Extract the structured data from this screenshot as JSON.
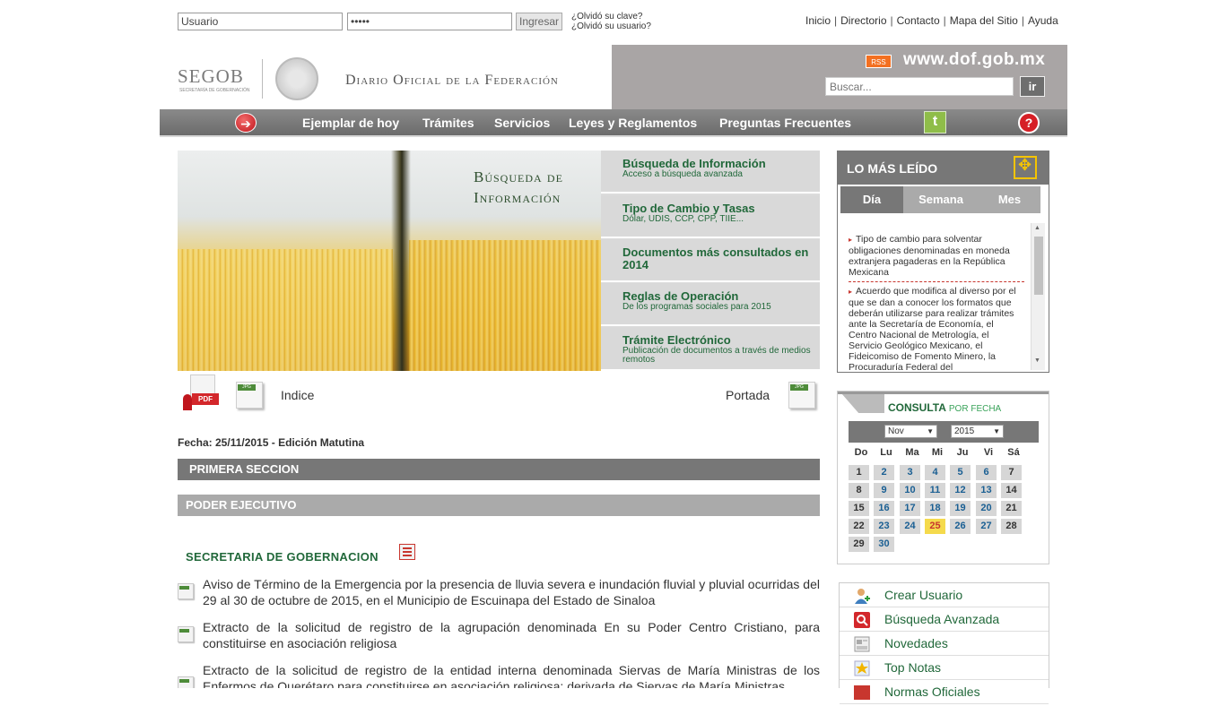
{
  "login": {
    "user_value": "Usuario",
    "password_value": "•••••",
    "submit_label": "Ingresar",
    "forgot_password": "¿Olvidó su clave?",
    "forgot_user": "¿Olvidó su usuario?"
  },
  "top_links": [
    "Inicio",
    "Directorio",
    "Contacto",
    "Mapa del Sitio",
    "Ayuda"
  ],
  "header": {
    "logo_text": "SEGOB",
    "logo_sub": "SECRETARÍA DE GOBERNACIÓN",
    "site_title": "Diario Oficial de la Federación",
    "rss_label": "RSS",
    "site_url": "www.dof.gob.mx",
    "search_placeholder": "Buscar...",
    "search_button": "ir"
  },
  "nav": {
    "items": [
      "Ejemplar de hoy",
      "Trámites",
      "Servicios",
      "Leyes y Reglamentos",
      "Preguntas Frecuentes"
    ],
    "back_icon": "back-arrow-icon",
    "twitter_icon": "twitter-icon",
    "help_icon": "help-icon"
  },
  "banner": {
    "title_line1": "Búsqueda de",
    "title_line2": "Información"
  },
  "feature_links": [
    {
      "title": "Búsqueda de Información",
      "sub": "Acceso a búsqueda avanzada"
    },
    {
      "title": "Tipo de Cambio y Tasas",
      "sub": "Dólar, UDIS, CCP, CPP, TIIE..."
    },
    {
      "title": "Documentos más consultados en 2014",
      "sub": ""
    },
    {
      "title": "Reglas de Operación",
      "sub": "De los programas sociales para 2015"
    },
    {
      "title": "Trámite Electrónico",
      "sub": "Publicación de documentos a través de medios remotos"
    }
  ],
  "downloads": {
    "pdf_label": "PDF",
    "jpg_label": "JPG",
    "indice": "Indice",
    "portada": "Portada"
  },
  "edition": {
    "fecha": "Fecha: 25/11/2015 - Edición Matutina",
    "section": "PRIMERA SECCION",
    "branch": "PODER EJECUTIVO",
    "department": "SECRETARIA DE GOBERNACION"
  },
  "documents": [
    "Aviso de Término de la Emergencia por la presencia de lluvia severa e inundación fluvial y pluvial ocurridas del 29 al 30 de octubre de 2015, en el Municipio de Escuinapa del Estado de Sinaloa",
    "Extracto de la solicitud de registro de la agrupación denominada En su Poder Centro Cristiano, para constituirse en asociación religiosa",
    "Extracto de la solicitud de registro de la entidad interna denominada Siervas de María Ministras de los Enfermos de Querétaro para constituirse en asociación religiosa; derivada de Siervas de María Ministras"
  ],
  "mas_leido": {
    "title": "LO MÁS LEÍDO",
    "tabs": [
      "Día",
      "Semana",
      "Mes"
    ],
    "items": [
      "Tipo de cambio para solventar obligaciones denominadas en moneda extranjera pagaderas en la República Mexicana",
      "Acuerdo que modifica al diverso por el que se dan a conocer los formatos que deberán utilizarse para realizar trámites ante la Secretaría de Economía, el Centro Nacional de Metrología, el Servicio Geológico Mexicano, el Fideicomiso de Fomento Minero, la Procuraduría Federal del"
    ]
  },
  "calendar": {
    "title": "CONSULTA",
    "title_small": "POR FECHA",
    "month": "Nov",
    "year": "2015",
    "dow": [
      "Do",
      "Lu",
      "Ma",
      "Mi",
      "Ju",
      "Vi",
      "Sá"
    ],
    "days": [
      "1",
      "2",
      "3",
      "4",
      "5",
      "6",
      "7",
      "8",
      "9",
      "10",
      "11",
      "12",
      "13",
      "14",
      "15",
      "16",
      "17",
      "18",
      "19",
      "20",
      "21",
      "22",
      "23",
      "24",
      "25",
      "26",
      "27",
      "28",
      "29",
      "30"
    ],
    "today": "25"
  },
  "side_links": [
    {
      "label": "Crear Usuario",
      "icon": "user-add-icon"
    },
    {
      "label": "Búsqueda Avanzada",
      "icon": "search-icon"
    },
    {
      "label": "Novedades",
      "icon": "news-icon"
    },
    {
      "label": "Top Notas",
      "icon": "star-icon"
    },
    {
      "label": "Normas Oficiales",
      "icon": "nom-icon"
    }
  ],
  "colors": {
    "green": "#21683a",
    "gray_bar": "#777777",
    "red": "#c8362e",
    "today": "#f5da4c"
  }
}
